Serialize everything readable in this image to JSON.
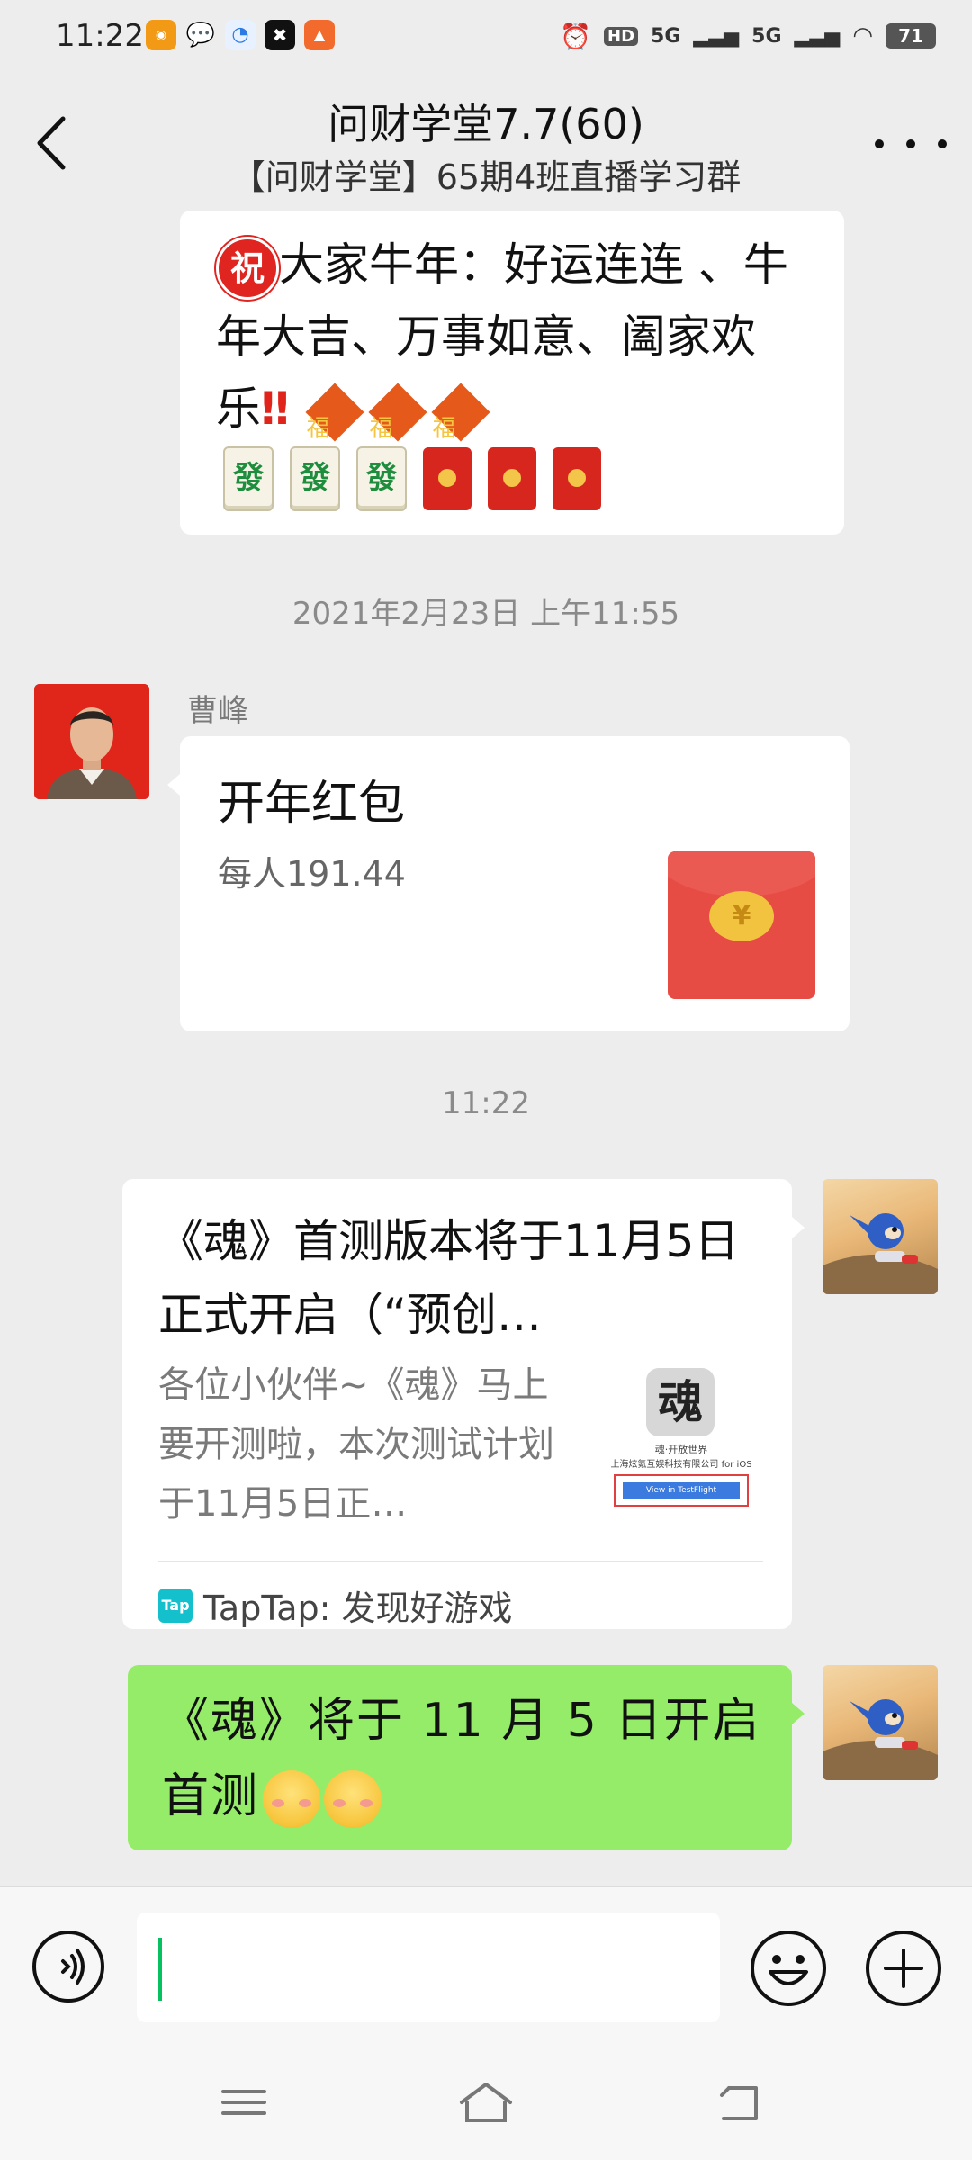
{
  "status_bar": {
    "time": "11:22",
    "hd_label": "HD",
    "signal_1": "5G",
    "signal_2": "5G",
    "battery": "71"
  },
  "header": {
    "title": "问财学堂7.7(60)",
    "subtitle": "【问财学堂】65期4班直播学习群"
  },
  "messages": {
    "first": {
      "text": "大家牛年：好运连连 、牛年大吉、万事如意、阖家欢乐",
      "badge": "祝",
      "exclaim": "‼",
      "fu": "福",
      "mahjong": "發"
    },
    "timestamp_1": "2021年2月23日 上午11:55",
    "red_packet": {
      "sender": "曹峰",
      "title": "开年红包",
      "amount": "每人191.44",
      "yen": "¥"
    },
    "timestamp_2": "11:22",
    "link_card": {
      "title": "《魂》首测版本将于11月5日正式开启（“预创…",
      "description": "各位小伙伴~《魂》马上要开测啦，本次测试计划于11月5日正…",
      "thumb_glyph": "魂",
      "thumb_caption_1": "魂·开放世界",
      "thumb_caption_2": "上海炫氪互娱科技有限公司 for iOS",
      "thumb_button": "View in TestFlight",
      "logo_text": "Tap",
      "source": "TapTap: 发现好游戏"
    },
    "green": {
      "text": "《魂》将于 11 月 5 日开启首测"
    }
  },
  "colors": {
    "background": "#ededed",
    "self_bubble": "#95ec69",
    "red_packet": "#e74c44",
    "caret": "#07c160"
  }
}
